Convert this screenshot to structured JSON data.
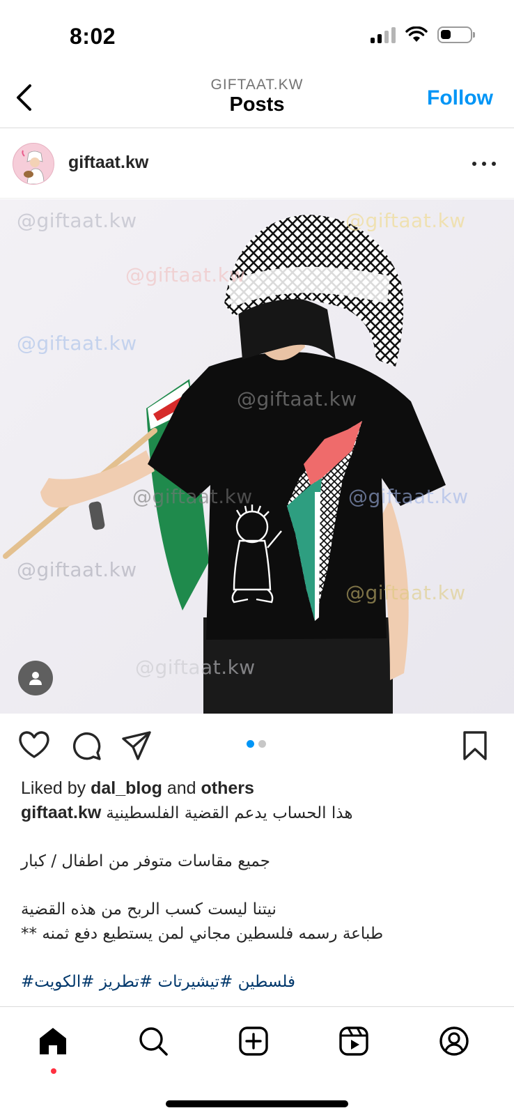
{
  "status_bar": {
    "time": "8:02",
    "battery_level": 0.35
  },
  "header": {
    "subtitle": "GIFTAAT.KW",
    "title": "Posts",
    "follow_label": "Follow"
  },
  "post": {
    "username": "giftaat.kw",
    "watermark_text": "@giftaat.kw",
    "carousel": {
      "count": 2,
      "active_index": 0
    },
    "likes": {
      "prefix": "Liked by",
      "user": "dal_blog",
      "middle": "and",
      "suffix": "others"
    },
    "caption": {
      "username": "giftaat.kw",
      "line1": "هذا الحساب يدعم القضية الفلسطينية",
      "line2": "جميع مقاسات متوفر من اطفال / كبار",
      "line3": "نيتنا ليست كسب الربح من هذه القضية",
      "line4": "** طباعة رسمه فلسطين مجاني لمن يستطيع دفع ثمنه",
      "hashtags": "#فلسطين #تيشيرتات #تطريز #الكويت"
    }
  },
  "icons": {
    "back": "chevron-left-icon",
    "more": "ellipsis-icon",
    "tag": "person-icon",
    "like": "heart-icon",
    "comment": "comment-icon",
    "share": "send-icon",
    "save": "bookmark-icon",
    "nav": [
      "home-icon",
      "search-icon",
      "create-icon",
      "reels-icon",
      "profile-icon"
    ]
  },
  "colors": {
    "accent": "#0095f6",
    "hashtag": "#00376b",
    "notification": "#ff3040",
    "carousel_active": "#0095f6",
    "carousel_inactive": "#c7c7c7"
  }
}
